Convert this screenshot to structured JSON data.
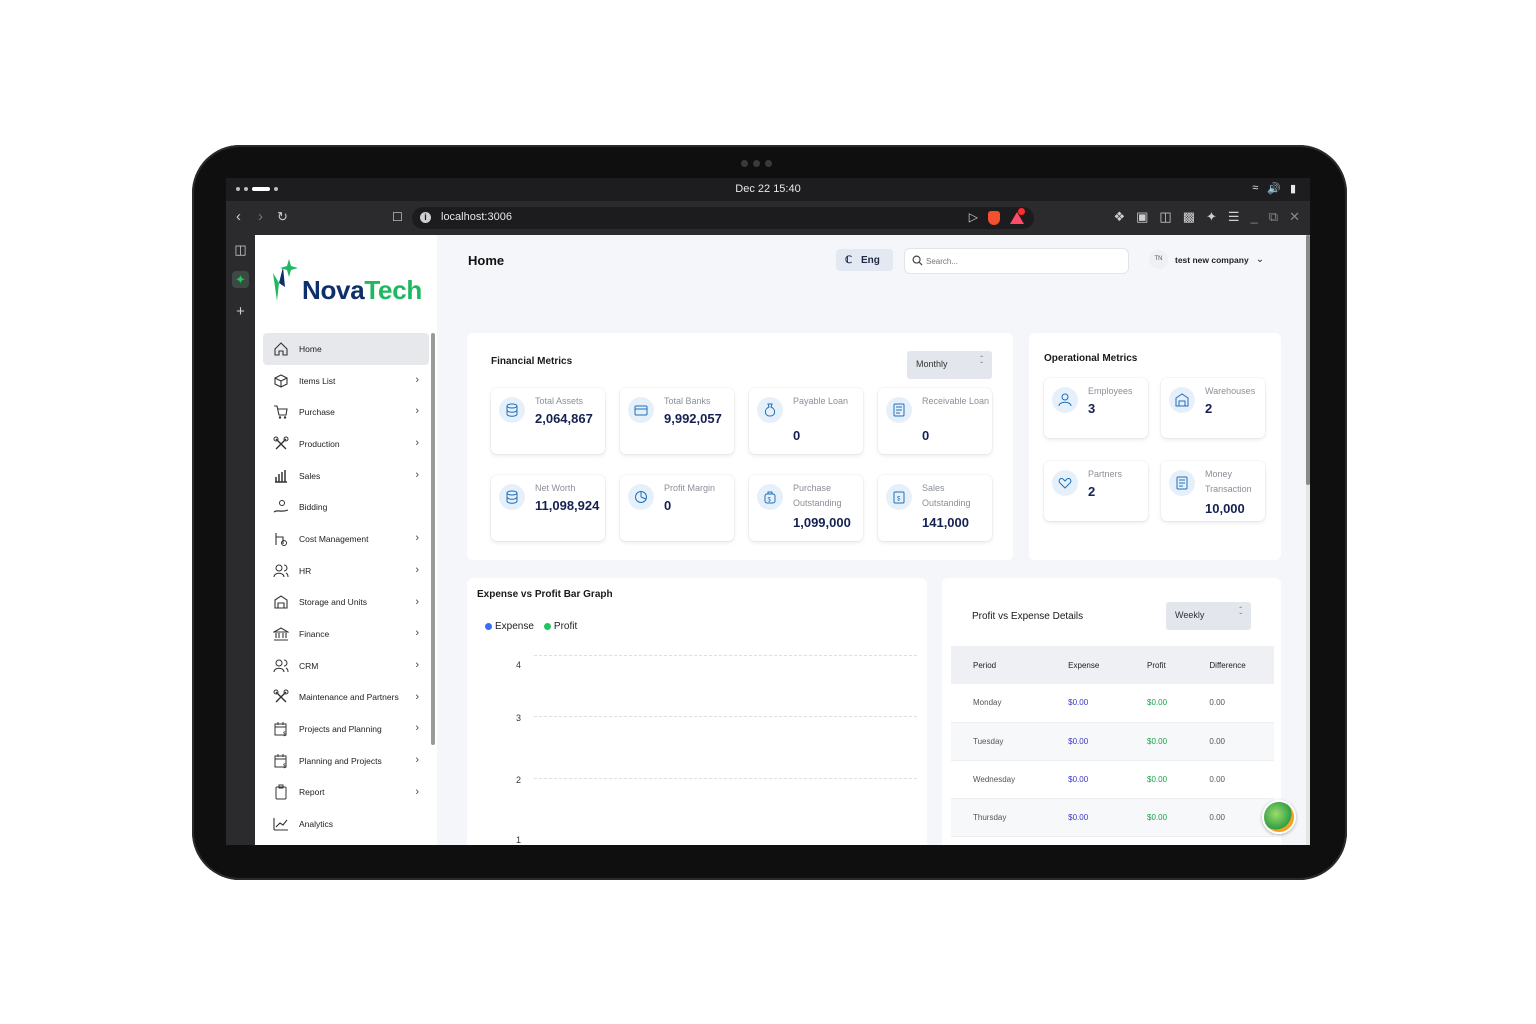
{
  "system": {
    "clock": "Dec 22  15:40",
    "tray_icons": [
      "wifi-icon",
      "volume-icon",
      "battery-icon"
    ]
  },
  "browser": {
    "url": "localhost:3006",
    "notification_count": ""
  },
  "brand": {
    "name_part1": "Nova",
    "name_part2": "Tech",
    "primary_color": "#0f2f6b",
    "accent_color": "#1fb861"
  },
  "sidebar": {
    "items": [
      {
        "label": "Home",
        "icon": "home-icon",
        "active": true,
        "has_chevron": false
      },
      {
        "label": "Items List",
        "icon": "box-icon",
        "active": false,
        "has_chevron": true
      },
      {
        "label": "Purchase",
        "icon": "cart-icon",
        "active": false,
        "has_chevron": true
      },
      {
        "label": "Production",
        "icon": "tools-icon",
        "active": false,
        "has_chevron": true
      },
      {
        "label": "Sales",
        "icon": "bar-chart-icon",
        "active": false,
        "has_chevron": true
      },
      {
        "label": "Bidding",
        "icon": "hand-coin-icon",
        "active": false,
        "has_chevron": false
      },
      {
        "label": "Cost Management",
        "icon": "cost-icon",
        "active": false,
        "has_chevron": true
      },
      {
        "label": "HR",
        "icon": "users-icon",
        "active": false,
        "has_chevron": true
      },
      {
        "label": "Storage and Units",
        "icon": "warehouse-icon",
        "active": false,
        "has_chevron": true
      },
      {
        "label": "Finance",
        "icon": "bank-icon",
        "active": false,
        "has_chevron": true
      },
      {
        "label": "CRM",
        "icon": "users-icon",
        "active": false,
        "has_chevron": true
      },
      {
        "label": "Maintenance and Partners",
        "icon": "tools-icon",
        "active": false,
        "has_chevron": true
      },
      {
        "label": "Projects and Planning",
        "icon": "calendar-dollar-icon",
        "active": false,
        "has_chevron": true
      },
      {
        "label": "Planning and Projects",
        "icon": "calendar-dollar-icon",
        "active": false,
        "has_chevron": true
      },
      {
        "label": "Report",
        "icon": "clipboard-icon",
        "active": false,
        "has_chevron": true
      },
      {
        "label": "Analytics",
        "icon": "trend-icon",
        "active": false,
        "has_chevron": false
      }
    ]
  },
  "header": {
    "title": "Home",
    "language": "Eng",
    "search_placeholder": "Search...",
    "user_initials": "TN",
    "company": "test new company"
  },
  "financial": {
    "title": "Financial Metrics",
    "period": "Monthly",
    "metrics": [
      {
        "label": "Total Assets",
        "value": "2,064,867",
        "icon": "database-icon"
      },
      {
        "label": "Total Banks",
        "value": "9,992,057",
        "icon": "card-icon"
      },
      {
        "label": "Payable Loan",
        "value": "0",
        "icon": "moneybag-icon"
      },
      {
        "label": "Receivable Loan",
        "value": "0",
        "icon": "receipt-icon"
      },
      {
        "label": "Net Worth",
        "value": "11,098,924",
        "icon": "database-icon"
      },
      {
        "label": "Profit Margin",
        "value": "0",
        "icon": "pie-icon"
      },
      {
        "label": "Purchase Outstanding",
        "value": "1,099,000",
        "icon": "bag-dollar-icon"
      },
      {
        "label": "Sales Outstanding",
        "value": "141,000",
        "icon": "clipboard-dollar-icon"
      }
    ]
  },
  "operational": {
    "title": "Operational Metrics",
    "metrics": [
      {
        "label": "Employees",
        "value": "3",
        "icon": "user-icon"
      },
      {
        "label": "Warehouses",
        "value": "2",
        "icon": "warehouse-icon"
      },
      {
        "label": "Partners",
        "value": "2",
        "icon": "handshake-heart-icon"
      },
      {
        "label": "Money Transaction",
        "value": "10,000",
        "icon": "receipt-icon"
      }
    ]
  },
  "bar_graph": {
    "title": "Expense vs Profit Bar Graph",
    "legend": [
      {
        "name": "Expense",
        "color": "#3b6ef5"
      },
      {
        "name": "Profit",
        "color": "#22c55e"
      }
    ],
    "y_ticks": [
      "4",
      "3",
      "2",
      "1"
    ]
  },
  "details": {
    "title": "Profit vs Expense Details",
    "period": "Weekly",
    "columns": [
      "Period",
      "Expense",
      "Profit",
      "Difference"
    ],
    "rows": [
      [
        "Monday",
        "$0.00",
        "$0.00",
        "0.00"
      ],
      [
        "Tuesday",
        "$0.00",
        "$0.00",
        "0.00"
      ],
      [
        "Wednesday",
        "$0.00",
        "$0.00",
        "0.00"
      ],
      [
        "Thursday",
        "$0.00",
        "$0.00",
        "0.00"
      ]
    ]
  }
}
